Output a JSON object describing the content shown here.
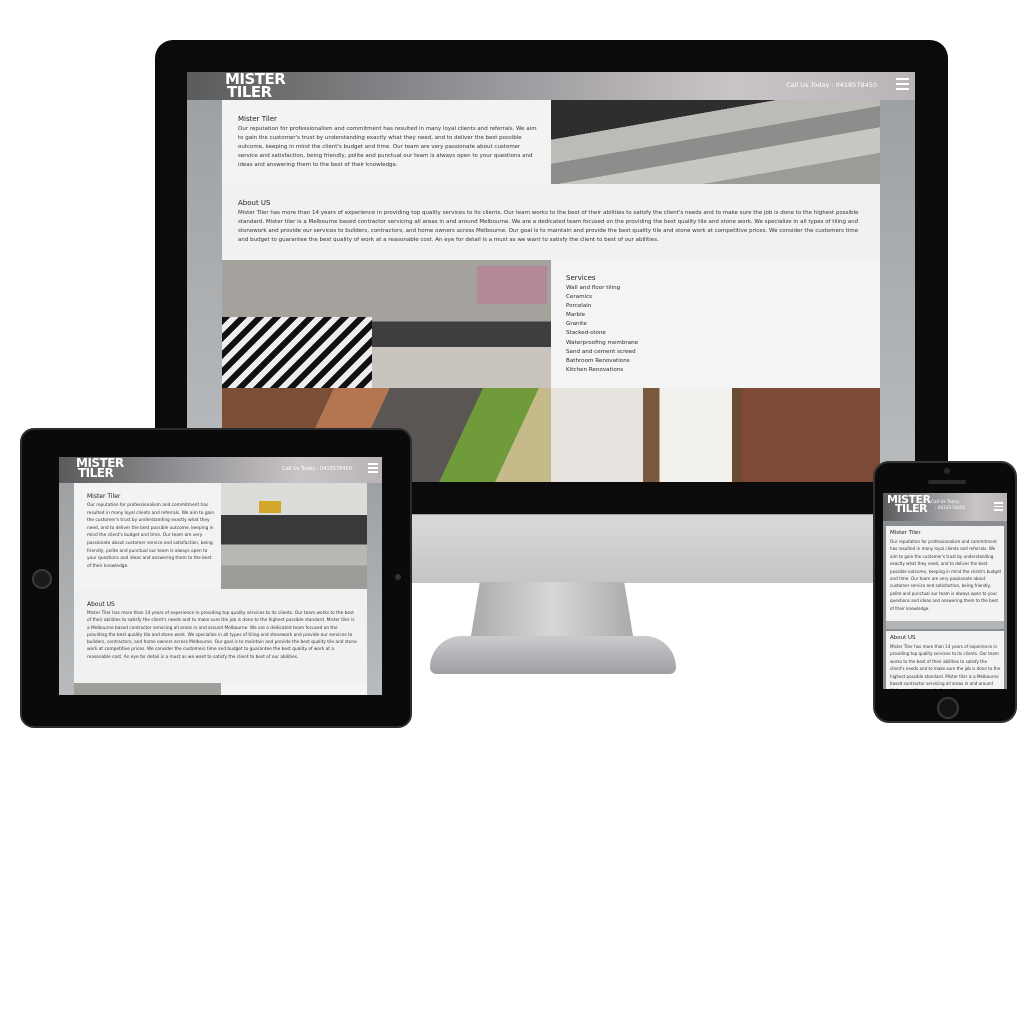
{
  "site": {
    "logo_line1": "MISTER",
    "logo_line2": "TILER",
    "call_text": "Call Us Today : 0418578450",
    "phone_call_line1": "Call Us Today",
    "phone_call_line2": ": 0418578450"
  },
  "intro": {
    "title": "Mister Tiler",
    "text": "Our reputation for professionalism and commitment has resulted in many loyal clients and referrals. We aim to gain the customer's trust by understanding exactly what they need, and to deliver the best possible outcome, keeping in mind the client's budget and time. Our team are very passionate about customer service and satisfaction, being friendly, polite and punctual our team is always open to your questions and ideas and answering them to the best of their knowledge."
  },
  "about": {
    "title": "About US",
    "text": "Mister Tiler has more than 14 years of experience in providing top quality services to its clients. Our team works to the best of their abilities to satisfy the client's needs and to make sure the job is done to the highest possible standard. Mister tiler is a Melbourne based contractor servicing all areas in and around Melbourne. We are a dedicated team focused on the providing the best quality tile and stone work. We specialize in all types of tiling and stonework and provide our services to builders, contractors, and home owners across Melbourne. Our goal is to maintain and provide the best quality tile and stone work at competitive prices. We consider the customers time and budget to guarantee the best quality of work at a reasonable cost. An eye for detail is a must as we want to satisfy the client to best of our abilities.",
    "text_phone": "Mister Tiler has more than 14 years of experience in providing top quality services to its clients. Our team works to the best of their abilities to satisfy the client's needs and to make sure the job is done to the highest possible standard. Mister tiler is a Melbourne based contractor servicing all areas in and around Melbourne. We are a dedicated team"
  },
  "services": {
    "title": "Services",
    "items": [
      "Wall and floor tiling",
      "Ceramics",
      "Porcelain",
      "Marble",
      "Granite",
      "Stacked-stone",
      "Waterproofing membrane",
      "Sand and cement screed",
      "Bathroom Renovations",
      "Kitchen Renovations"
    ]
  },
  "icons": {
    "menu": "hamburger-menu-icon"
  }
}
